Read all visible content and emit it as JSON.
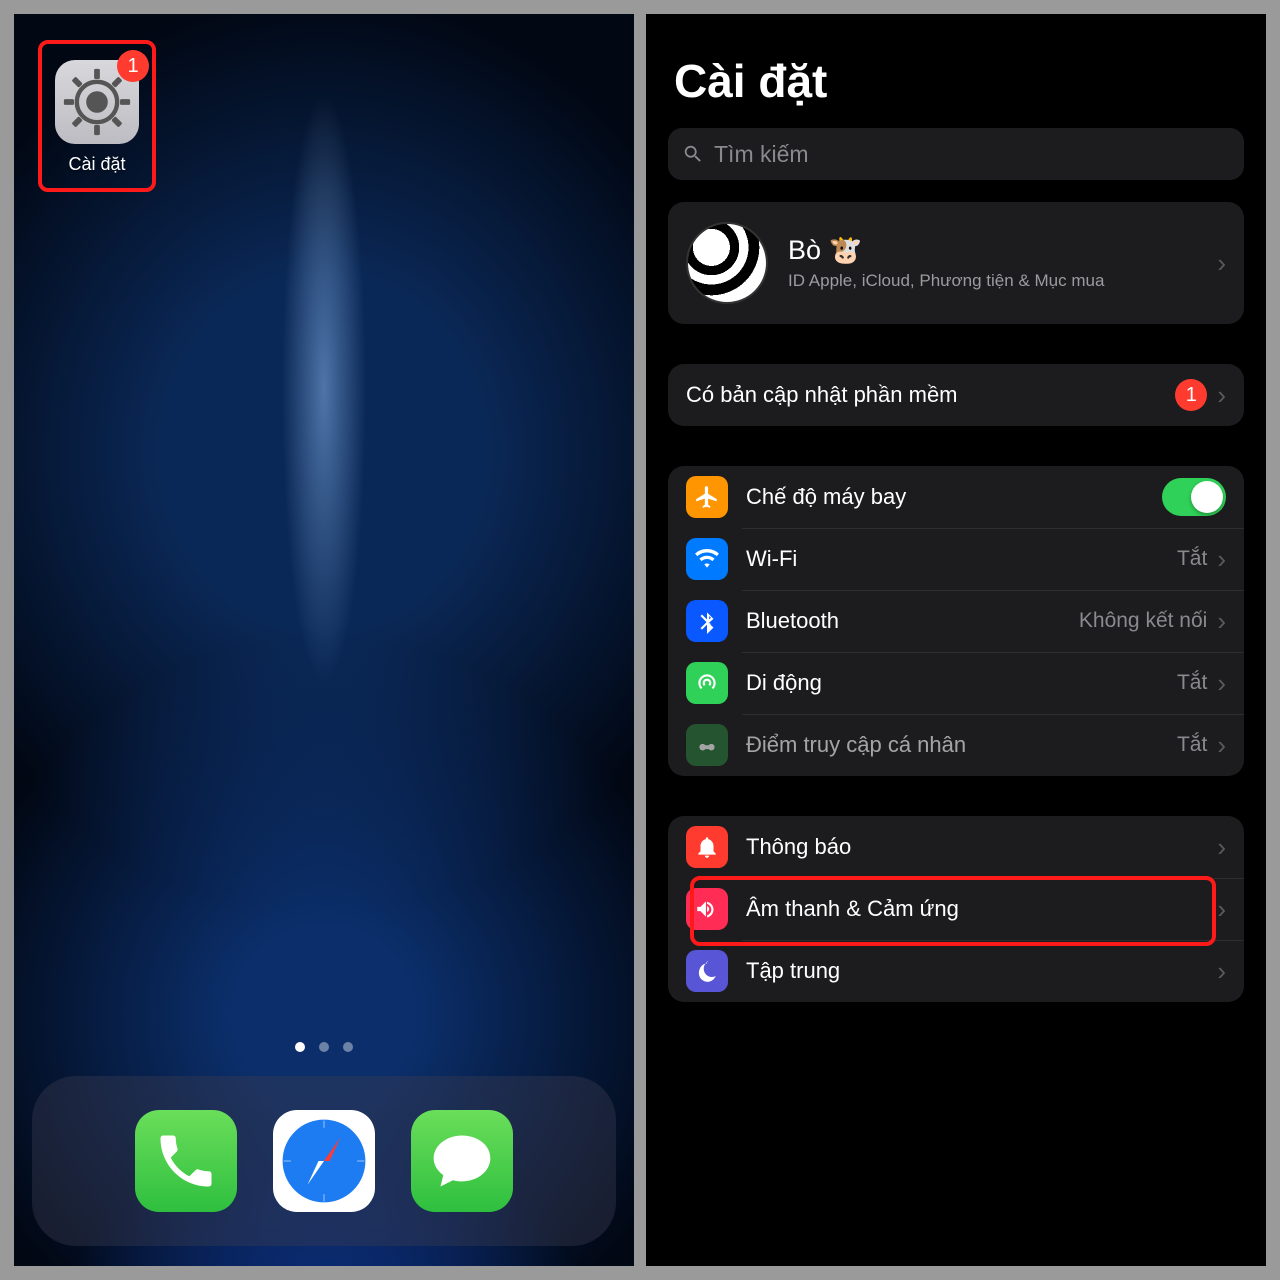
{
  "homescreen": {
    "app_label": "Cài đặt",
    "badge": "1"
  },
  "settings": {
    "title": "Cài đặt",
    "search_placeholder": "Tìm kiếm",
    "profile": {
      "name": "Bò 🐮",
      "subtitle": "ID Apple, iCloud, Phương tiện & Mục mua"
    },
    "update": {
      "label": "Có bản cập nhật phần mềm",
      "badge": "1"
    },
    "rows": {
      "airplane": "Chế độ máy bay",
      "wifi": "Wi-Fi",
      "wifi_val": "Tắt",
      "bluetooth": "Bluetooth",
      "bluetooth_val": "Không kết nối",
      "cellular": "Di động",
      "cellular_val": "Tắt",
      "hotspot": "Điểm truy cập cá nhân",
      "hotspot_val": "Tắt",
      "notifications": "Thông báo",
      "sounds": "Âm thanh & Cảm ứng",
      "focus": "Tập trung"
    }
  }
}
